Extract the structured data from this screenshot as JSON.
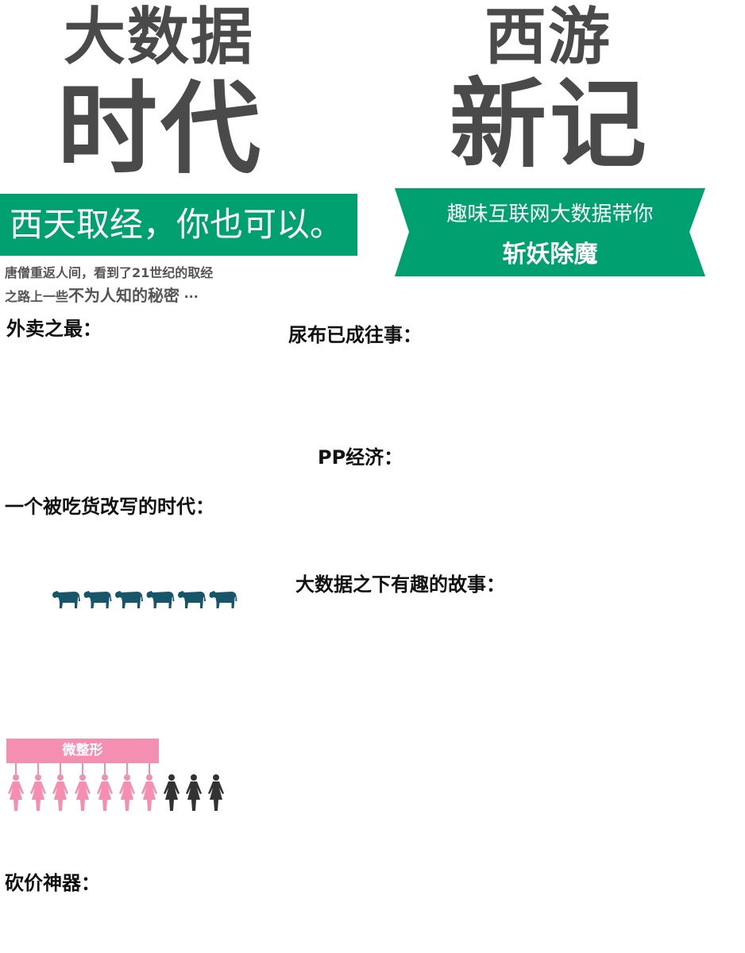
{
  "title": {
    "left_line1": "大数据",
    "left_line2": "时代",
    "right_line1": "西游",
    "right_line2": "新记"
  },
  "banner_left": "西天取经，你也可以。",
  "banner_right": {
    "line1": "趣味互联网大数据带你",
    "line2": "斩妖除魔"
  },
  "subtext": {
    "part1": "唐僧重返人间，看到了21世纪的取经",
    "part2": "之路上一些",
    "part3": "不为人知的秘密",
    "part4": " ···"
  },
  "sections": {
    "waimai": "外卖之最：",
    "niaobu": "尿布已成往事：",
    "pp": "PP经济：",
    "chihuo": "一个被吃货改写的时代：",
    "story": "大数据之下有趣的故事：",
    "kanjia": "砍价神器："
  },
  "cow_chart": {
    "count": 6,
    "color": "#17556a"
  },
  "women_chart": {
    "label": "微整形",
    "highlighted": 7,
    "total": 10,
    "highlight_color": "#f48fb1",
    "other_color": "#333333"
  },
  "colors": {
    "accent_green": "#00a071",
    "title_gray": "#4a4a4a"
  }
}
